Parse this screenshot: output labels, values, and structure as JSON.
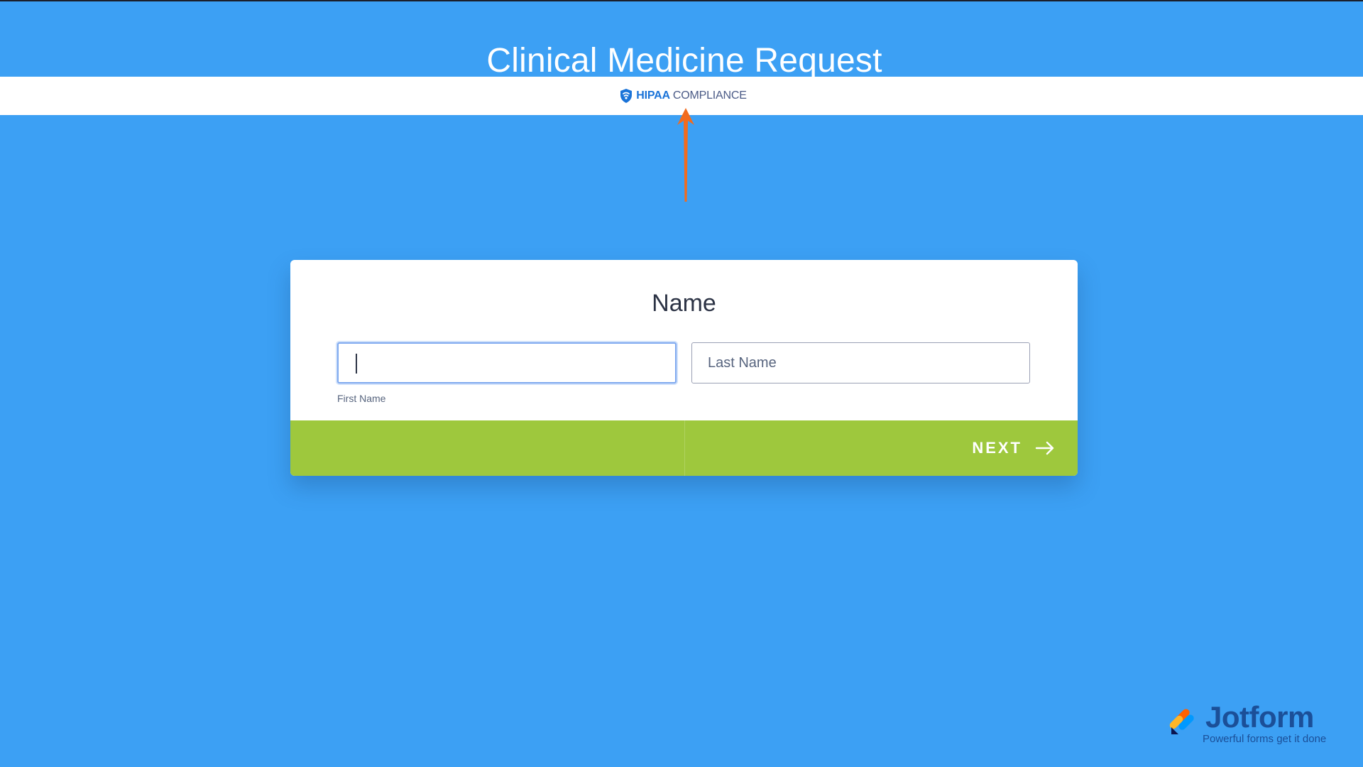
{
  "header": {
    "title": "Clinical Medicine Request"
  },
  "hipaa": {
    "strong": "HIPAA",
    "light": "COMPLIANCE",
    "icon": "shield-icon"
  },
  "colors": {
    "background": "#3ca0f4",
    "nav_bar": "#9ec83d",
    "hipaa_blue": "#1a73d8",
    "annotation_arrow": "#f26b1d"
  },
  "form": {
    "question": "Name",
    "first_name": {
      "value": "",
      "sublabel": "First Name"
    },
    "last_name": {
      "value": "",
      "placeholder": "Last Name"
    },
    "next_label": "NEXT"
  },
  "brand": {
    "name": "Jotform",
    "tagline": "Powerful forms get it done"
  }
}
